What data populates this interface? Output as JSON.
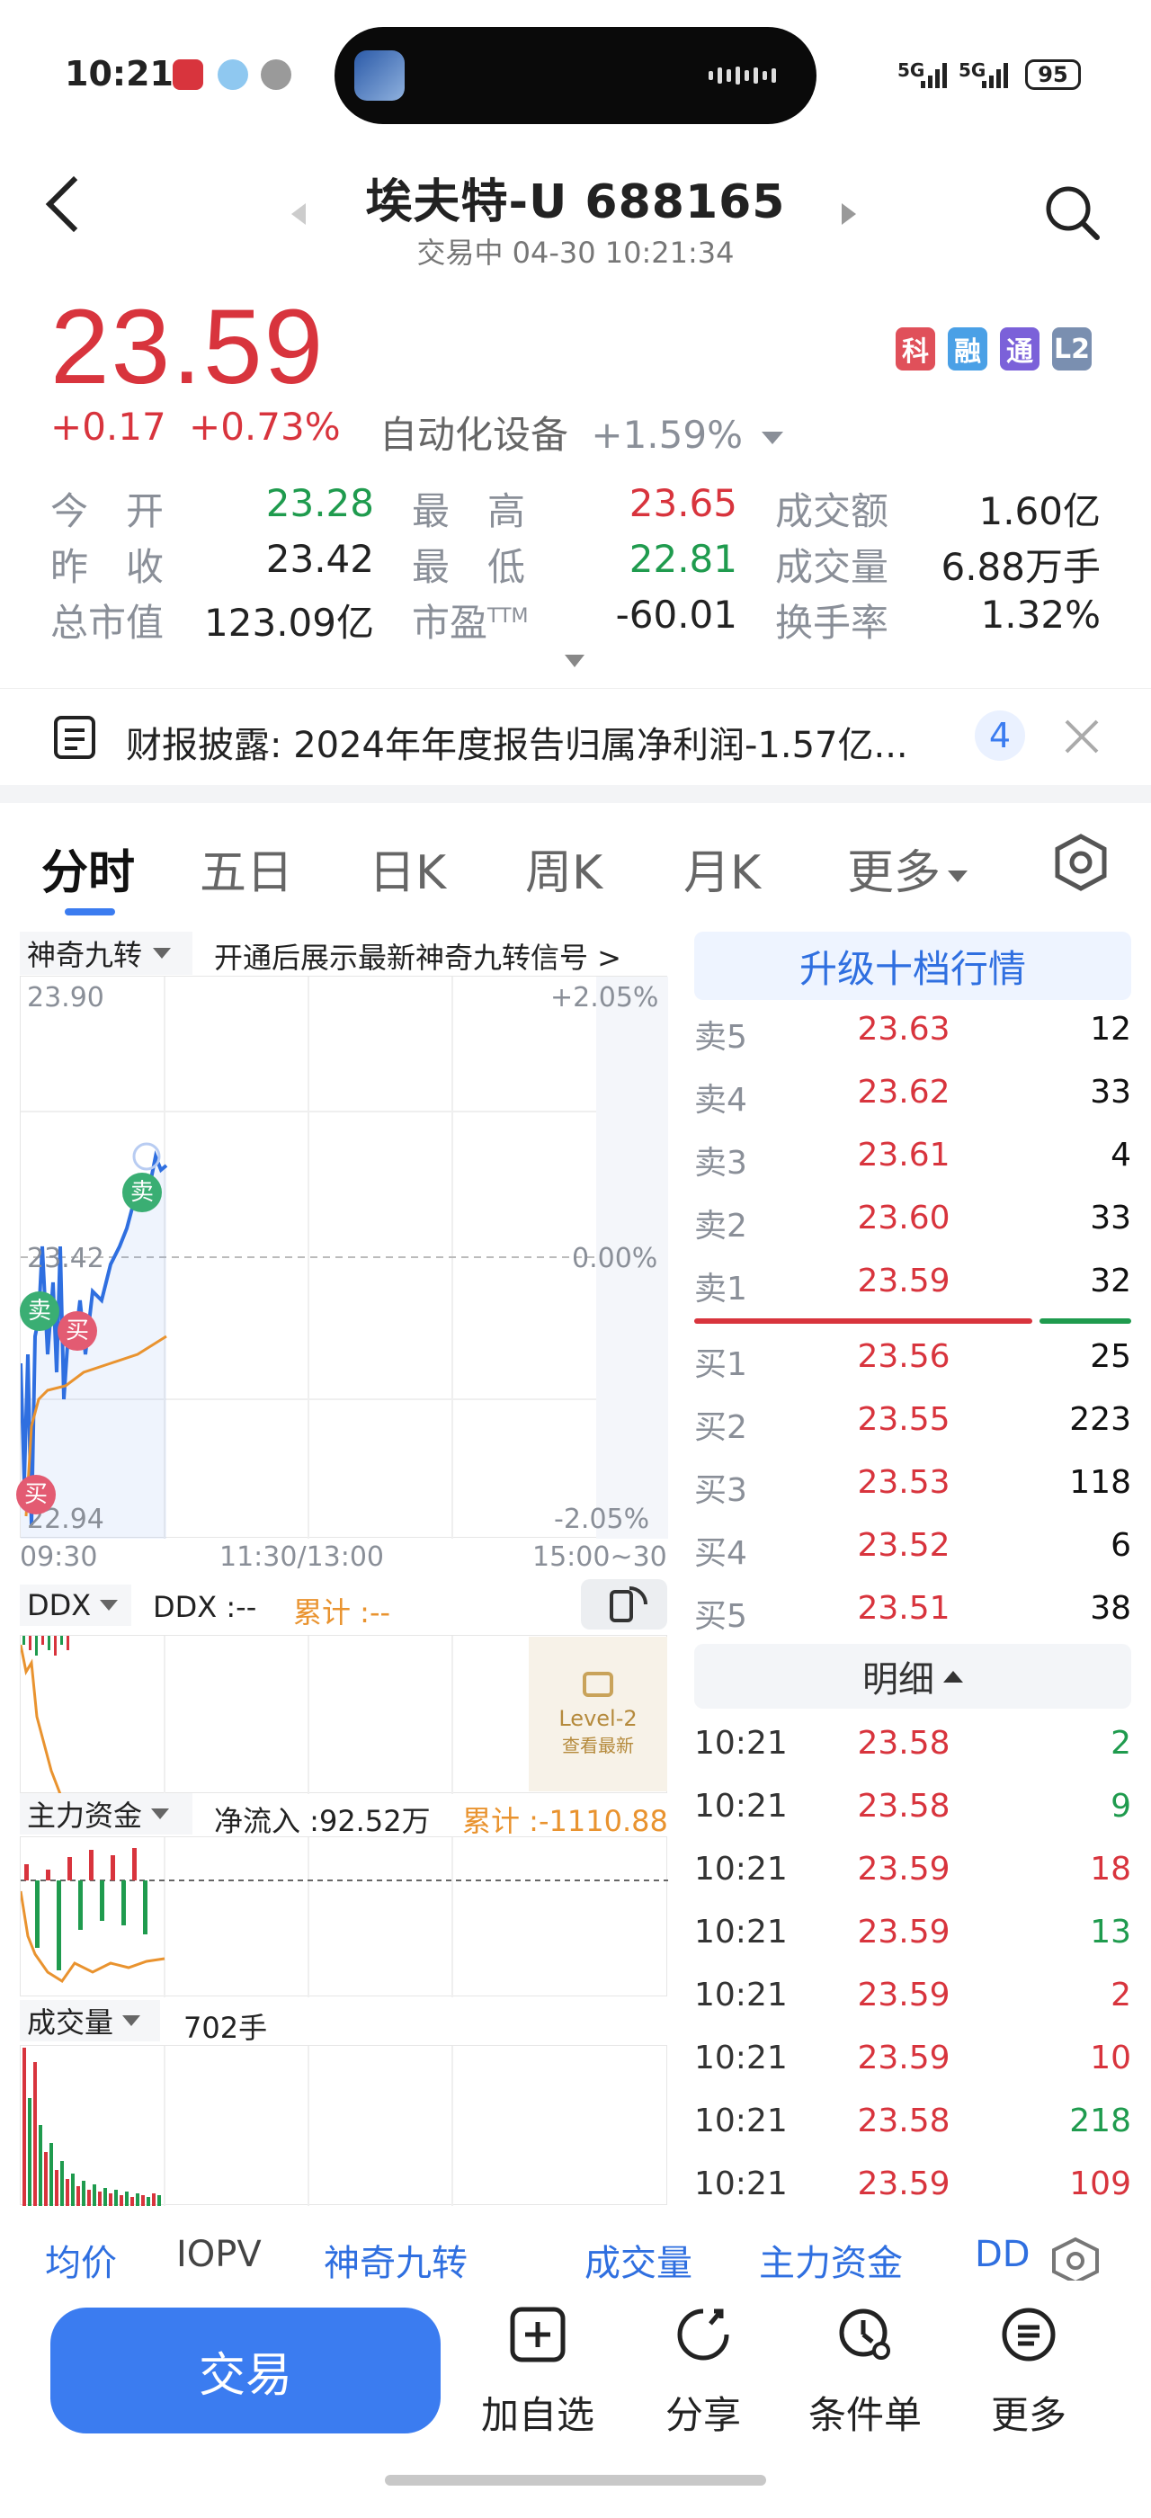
{
  "status": {
    "time": "10:21",
    "battery": "95",
    "net1": "5G",
    "net2": "5G"
  },
  "header": {
    "title": "埃夫特-U 688165",
    "subtitle": "交易中 04-30 10:21:34"
  },
  "quote": {
    "price": "23.59",
    "change": "+0.17",
    "change_pct": "+0.73%",
    "sector": "自动化设备",
    "sector_pct": "+1.59%",
    "badges": [
      {
        "text": "科",
        "color": "#e0505a"
      },
      {
        "text": "融",
        "color": "#4aa0e6"
      },
      {
        "text": "通",
        "color": "#7b61d9"
      },
      {
        "text": "L2",
        "color": "#7a8fb0"
      }
    ]
  },
  "stats": {
    "open_label": "今　开",
    "open": "23.28",
    "high_label": "最　高",
    "high": "23.65",
    "amount_label": "成交额",
    "amount": "1.60亿",
    "prev_label": "昨　收",
    "prev": "23.42",
    "low_label": "最　低",
    "low": "22.81",
    "volume_label": "成交量",
    "volume": "6.88万手",
    "mcap_label": "总市值",
    "mcap": "123.09亿",
    "pe_label": "市盈",
    "pe_sup": "TTM",
    "pe": "-60.01",
    "turnover_label": "换手率",
    "turnover": "1.32%"
  },
  "notice": {
    "text": "财报披露: 2024年年度报告归属净利润-1.57亿...",
    "count": "4"
  },
  "tabs": [
    "分时",
    "五日",
    "日K",
    "周K",
    "月K",
    "更多"
  ],
  "chart": {
    "indicator": "神奇九转",
    "indicator_tip": "开通后展示最新神奇九转信号 >",
    "y_top": "23.90",
    "y_mid": "23.42",
    "y_bottom": "22.94",
    "pct_top": "+2.05%",
    "pct_mid": "0.00%",
    "pct_bottom": "-2.05%",
    "x_labels": [
      "09:30",
      "11:30/13:00",
      "15:00~30"
    ],
    "sell_mark": "卖",
    "buy_mark": "买",
    "colors": {
      "price_line": "#2f6fe0",
      "avg_line": "#e9932f",
      "up": "#d8343d",
      "down": "#1f9b4e"
    }
  },
  "ddx": {
    "label": "DDX",
    "value_label": "DDX :--",
    "cum_label": "累计 :--",
    "lock_title": "Level-2",
    "lock_sub": "查看最新"
  },
  "capital": {
    "label": "主力资金",
    "net_label": "净流入 :92.52万",
    "cum_label": "累计 :-1110.88"
  },
  "volume_panel": {
    "label": "成交量",
    "value": "702手"
  },
  "orderbook": {
    "upgrade": "升级十档行情",
    "asks": [
      {
        "label": "卖5",
        "price": "23.63",
        "qty": "12"
      },
      {
        "label": "卖4",
        "price": "23.62",
        "qty": "33"
      },
      {
        "label": "卖3",
        "price": "23.61",
        "qty": "4"
      },
      {
        "label": "卖2",
        "price": "23.60",
        "qty": "33"
      },
      {
        "label": "卖1",
        "price": "23.59",
        "qty": "32"
      }
    ],
    "bids": [
      {
        "label": "买1",
        "price": "23.56",
        "qty": "25"
      },
      {
        "label": "买2",
        "price": "23.55",
        "qty": "223"
      },
      {
        "label": "买3",
        "price": "23.53",
        "qty": "118"
      },
      {
        "label": "买4",
        "price": "23.52",
        "qty": "6"
      },
      {
        "label": "买5",
        "price": "23.51",
        "qty": "38"
      }
    ]
  },
  "ticks": {
    "title": "明细",
    "rows": [
      {
        "time": "10:21",
        "price": "23.58",
        "qty": "2",
        "dir": "down"
      },
      {
        "time": "10:21",
        "price": "23.58",
        "qty": "9",
        "dir": "down"
      },
      {
        "time": "10:21",
        "price": "23.59",
        "qty": "18",
        "dir": "up"
      },
      {
        "time": "10:21",
        "price": "23.59",
        "qty": "13",
        "dir": "down"
      },
      {
        "time": "10:21",
        "price": "23.59",
        "qty": "2",
        "dir": "up"
      },
      {
        "time": "10:21",
        "price": "23.59",
        "qty": "10",
        "dir": "up"
      },
      {
        "time": "10:21",
        "price": "23.58",
        "qty": "218",
        "dir": "down"
      },
      {
        "time": "10:21",
        "price": "23.59",
        "qty": "109",
        "dir": "up"
      }
    ]
  },
  "indicator_tabs": [
    "均价",
    "IOPV",
    "神奇九转",
    "成交量",
    "主力资金",
    "DD"
  ],
  "bottom": {
    "trade": "交易",
    "add": "加自选",
    "share": "分享",
    "condition": "条件单",
    "more": "更多"
  }
}
